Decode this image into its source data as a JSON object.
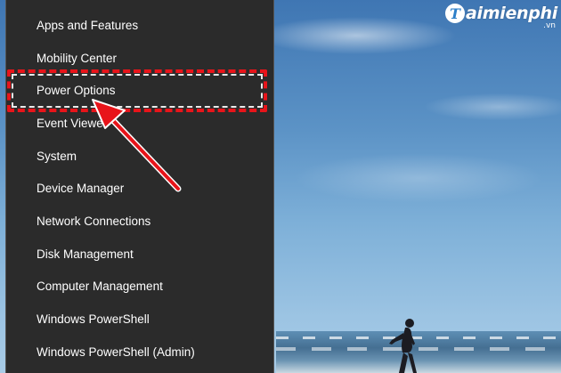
{
  "menu": {
    "items": [
      {
        "label": "Apps and Features"
      },
      {
        "label": "Mobility Center"
      },
      {
        "label": "Power Options"
      },
      {
        "label": "Event Viewer"
      },
      {
        "label": "System"
      },
      {
        "label": "Device Manager"
      },
      {
        "label": "Network Connections"
      },
      {
        "label": "Disk Management"
      },
      {
        "label": "Computer Management"
      },
      {
        "label": "Windows PowerShell"
      },
      {
        "label": "Windows PowerShell (Admin)"
      }
    ]
  },
  "watermark": {
    "logo_letter": "T",
    "name": "aimienphi",
    "suffix": ".vn"
  },
  "annotation": {
    "highlight_color": "#e8141a",
    "arrow_color": "#e8141a"
  }
}
